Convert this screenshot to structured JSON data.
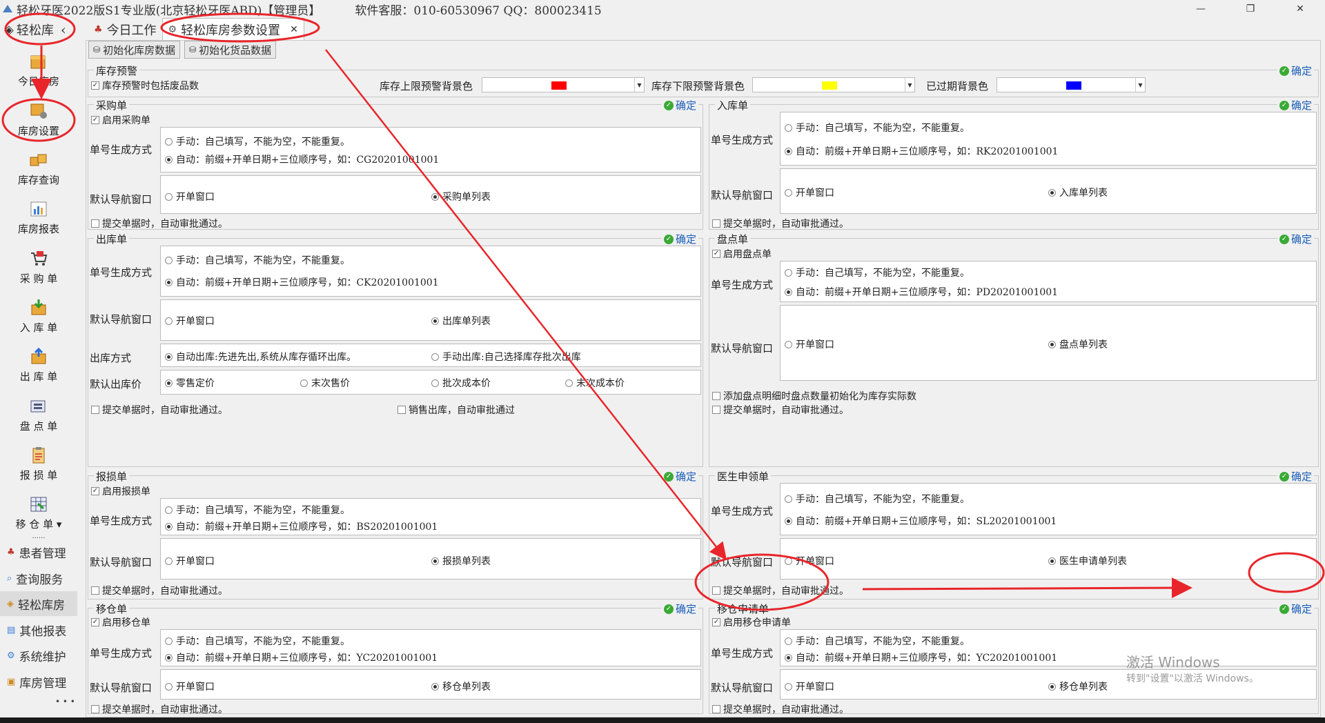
{
  "window": {
    "title": "轻松牙医2022版S1专业版(北京轻松牙医ABD)【管理员】",
    "support": "软件客服：010-60530967 QQ：800023415",
    "controls": [
      "—",
      "❐",
      "✕"
    ]
  },
  "nav": {
    "header": "轻松库",
    "collapse": "‹",
    "buttons": [
      "今日库房",
      "库房设置",
      "库存查询",
      "库房报表",
      "采 购 单",
      "入 库 单",
      "出 库 单",
      "盘 点 单",
      "报 损 单",
      "移 仓 单 ▾"
    ],
    "more_dots": "......",
    "list": [
      "患者管理",
      "查询服务",
      "轻松库房",
      "其他报表",
      "系统维护",
      "库房管理"
    ],
    "selected_list": "轻松库房",
    "ellipsis": "• • •"
  },
  "tabs": [
    {
      "label": "今日工作",
      "active": false
    },
    {
      "label": "轻松库房参数设置",
      "active": true,
      "close": "✕"
    }
  ],
  "toolbar": {
    "init_warehouse": "初始化库房数据",
    "init_goods": "初始化货品数据"
  },
  "common": {
    "ok": "确定",
    "numgen": "单号生成方式",
    "nav_window": "默认导航窗口",
    "manual": "手动：自己填写，不能为空，不能重复。",
    "open_window": "开单窗口",
    "auto_approve": "提交单据时，自动审批通过。"
  },
  "stock_warning": {
    "title": "库存预警",
    "include_waste": "库存预警时包括废品数",
    "upper_label": "库存上限预警背景色",
    "upper_color": "#ff0000",
    "lower_label": "库存下限预警背景色",
    "lower_color": "#ffff00",
    "expired_label": "已过期背景色",
    "expired_color": "#0000ff"
  },
  "purchase": {
    "title": "采购单",
    "enable": "启用采购单",
    "auto": "自动：前缀+开单日期+三位顺序号，如：CG20201001001",
    "list": "采购单列表"
  },
  "inbound": {
    "title": "入库单",
    "auto": "自动：前缀+开单日期+三位顺序号，如：RK20201001001",
    "list": "入库单列表"
  },
  "outbound": {
    "title": "出库单",
    "auto": "自动：前缀+开单日期+三位顺序号，如：CK20201001001",
    "list": "出库单列表",
    "method_label": "出库方式",
    "method_auto": "自动出库:先进先出,系统从库存循环出库。",
    "method_manual": "手动出库:自己选择库存批次出库",
    "price_label": "默认出库价",
    "prices": [
      "零售定价",
      "末次售价",
      "批次成本价",
      "末次成本价"
    ],
    "sale_auto": "销售出库，自动审批通过"
  },
  "inventory": {
    "title": "盘点单",
    "enable": "启用盘点单",
    "auto": "自动：前缀+开单日期+三位顺序号，如：PD20201001001",
    "list": "盘点单列表",
    "init_qty": "添加盘点明细时盘点数量初始化为库存实际数"
  },
  "damage": {
    "title": "报损单",
    "enable": "启用报损单",
    "auto": "自动：前缀+开单日期+三位顺序号，如：BS20201001001",
    "list": "报损单列表"
  },
  "doctor": {
    "title": "医生申领单",
    "auto": "自动：前缀+开单日期+三位顺序号，如：SL20201001001",
    "list": "医生申请单列表"
  },
  "transfer": {
    "title": "移仓单",
    "enable": "启用移仓单",
    "auto": "自动：前缀+开单日期+三位顺序号，如：YC20201001001",
    "list": "移仓单列表"
  },
  "transfer_req": {
    "title": "移仓申请单",
    "enable": "启用移仓申请单",
    "auto": "自动：前缀+开单日期+三位顺序号，如：YC20201001001",
    "list": "移仓单列表"
  },
  "watermark": {
    "line1": "激活 Windows",
    "line2": "转到\"设置\"以激活 Windows。"
  },
  "annotation_color": "#e8252a"
}
